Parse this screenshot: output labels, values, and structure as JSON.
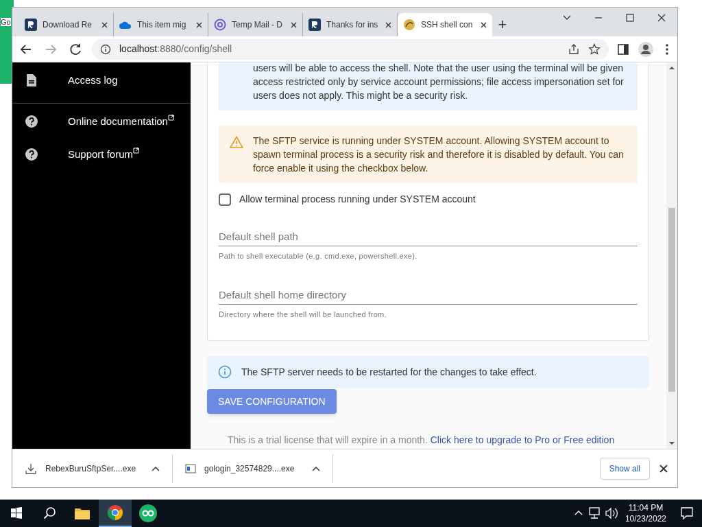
{
  "background": {
    "app_label": "Go"
  },
  "browser": {
    "tabs": [
      {
        "label": "Download Re",
        "kind": "r",
        "selected": false
      },
      {
        "label": "This item mig",
        "kind": "cloud",
        "selected": false
      },
      {
        "label": "Temp Mail - D",
        "kind": "at",
        "selected": false
      },
      {
        "label": "Thanks for ins",
        "kind": "r",
        "selected": false
      },
      {
        "label": "SSH shell con",
        "kind": "shell",
        "selected": true
      }
    ],
    "new_tab": "+",
    "address": {
      "host": "localhost",
      "path": ":8880/config/shell"
    }
  },
  "sidebar": {
    "items": [
      {
        "label": "Access log",
        "kind": "doc",
        "external": false
      },
      {
        "label": "Online documentation",
        "kind": "help",
        "external": true
      },
      {
        "label": "Support forum",
        "kind": "help",
        "external": true
      }
    ]
  },
  "main": {
    "info_top": "users will be able to access the shell. Note that the user using the terminal will be given access restricted only by service account permissions; file access impersonation set for users does not apply. This might be a security risk.",
    "warning": "The SFTP service is running under SYSTEM account. Allowing SYSTEM account to spawn terminal process is a security risk and therefore it is disabled by default. You can force enable it using the checkbox below.",
    "checkbox": {
      "label": "Allow terminal process running under SYSTEM account",
      "checked": false
    },
    "fields": [
      {
        "placeholder": "Default shell path",
        "hint": "Path to shell executable (e.g. cmd.exe, powershell.exe)."
      },
      {
        "placeholder": "Default shell home directory",
        "hint": "Directory where the shell will be launched from."
      }
    ],
    "restart_note": "The SFTP server needs to be restarted for the changes to take effect.",
    "save_button": "SAVE CONFIGURATION",
    "trial_text": "This is a trial license that will expire in a month.",
    "trial_link": "Click here to upgrade to Pro or Free edition"
  },
  "downloads": {
    "items": [
      {
        "name": "RebexBuruSftpSer....exe",
        "kind": "download"
      },
      {
        "name": "gologin_32574829....exe",
        "kind": "installer"
      }
    ],
    "show_all": "Show all"
  },
  "taskbar": {
    "apps": [
      {
        "kind": "folder",
        "selected": false
      },
      {
        "kind": "chrome",
        "selected": true
      },
      {
        "kind": "go",
        "selected": false
      }
    ],
    "time": "11:04 PM",
    "date": "10/23/2022"
  }
}
